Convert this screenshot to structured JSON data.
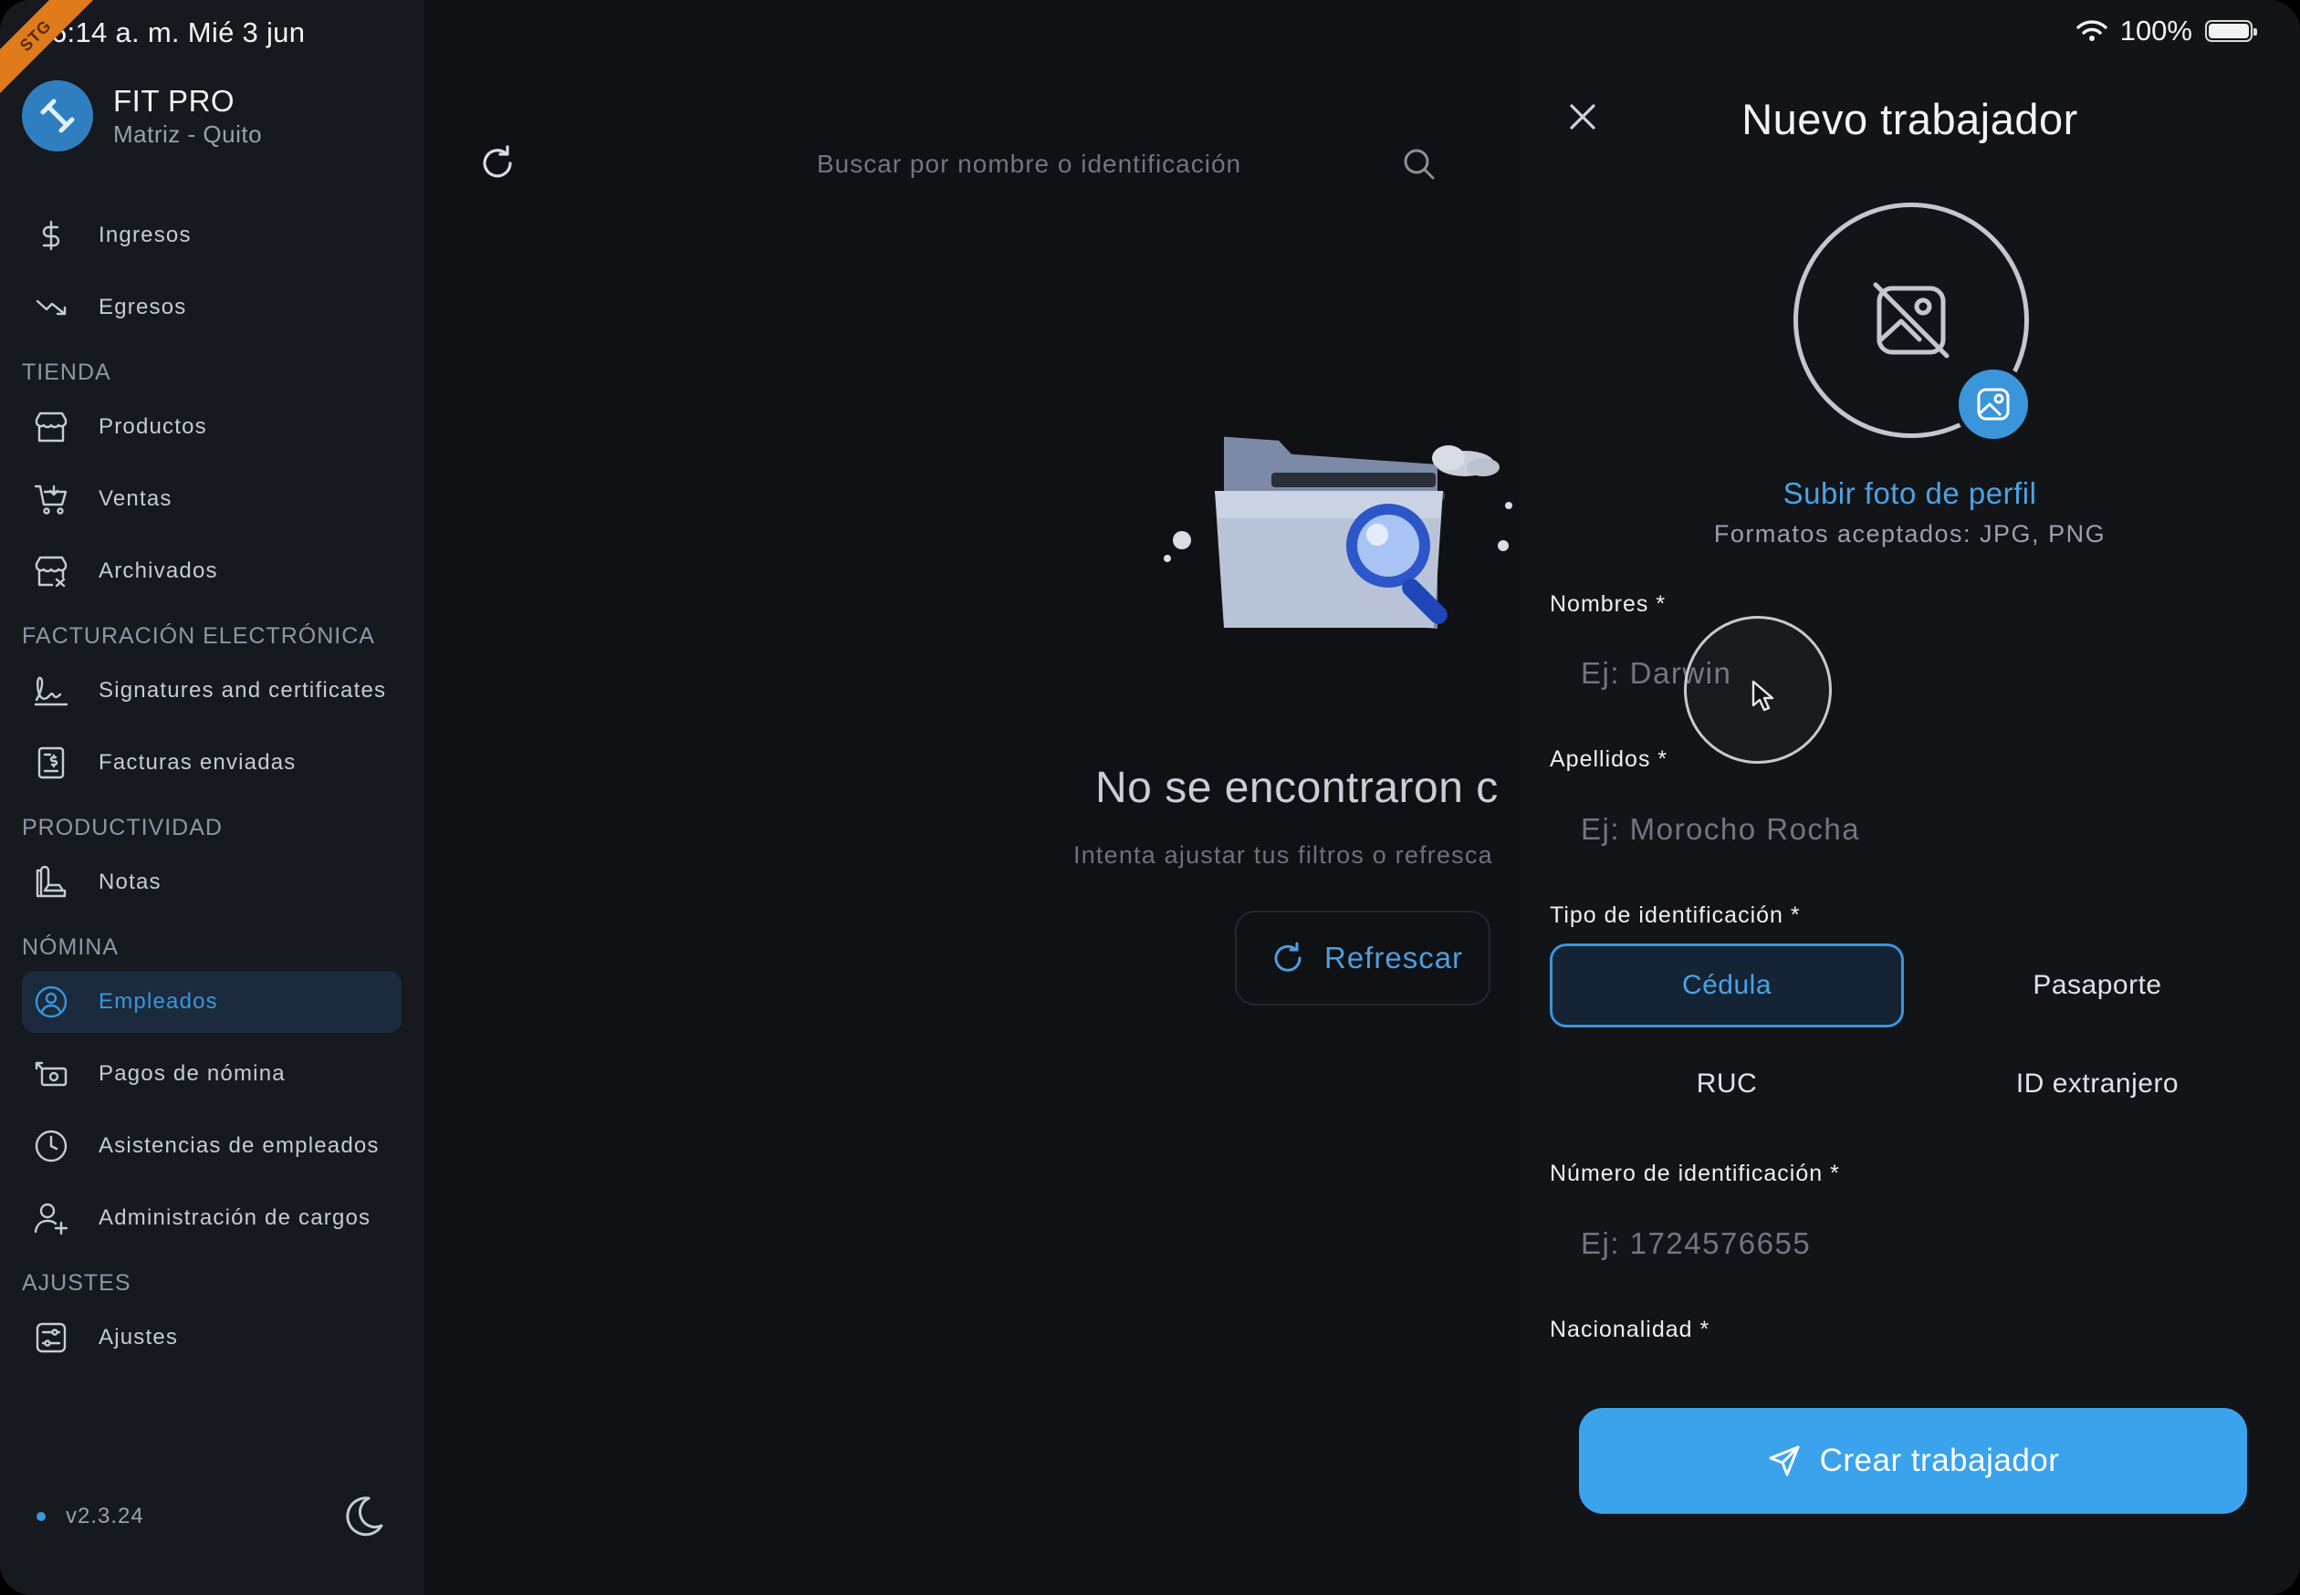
{
  "status_bar": {
    "time": "6:14 a. m.  Mié 3 jun",
    "battery": "100%",
    "ribbon": "STG"
  },
  "brand": {
    "name": "FIT PRO",
    "location": "Matriz - Quito"
  },
  "sidebar": {
    "top_items": [
      {
        "label": "Ingresos",
        "icon": "dollar-icon"
      },
      {
        "label": "Egresos",
        "icon": "trend-down-icon"
      }
    ],
    "sections": [
      {
        "title": "TIENDA",
        "items": [
          {
            "label": "Productos",
            "icon": "store-icon"
          },
          {
            "label": "Ventas",
            "icon": "cart-icon"
          },
          {
            "label": "Archivados",
            "icon": "archived-store-icon"
          }
        ]
      },
      {
        "title": "FACTURACIÓN ELECTRÓNICA",
        "items": [
          {
            "label": "Signatures and certificates",
            "icon": "signature-icon"
          },
          {
            "label": "Facturas enviadas",
            "icon": "receipt-icon"
          }
        ]
      },
      {
        "title": "PRODUCTIVIDAD",
        "items": [
          {
            "label": "Notas",
            "icon": "clipboard-icon"
          }
        ]
      },
      {
        "title": "NÓMINA",
        "items": [
          {
            "label": "Empleados",
            "icon": "user-circle-icon",
            "active": true
          },
          {
            "label": "Pagos de nómina",
            "icon": "money-icon"
          },
          {
            "label": "Asistencias de empleados",
            "icon": "clock-icon"
          },
          {
            "label": "Administración de cargos",
            "icon": "user-plus-icon"
          }
        ]
      },
      {
        "title": "AJUSTES",
        "items": [
          {
            "label": "Ajustes",
            "icon": "settings-icon"
          }
        ]
      }
    ],
    "version": "v2.3.24"
  },
  "main": {
    "search_placeholder": "Buscar por nombre o identificación",
    "empty_title": "No se encontraron c",
    "empty_subtitle": "Intenta ajustar tus filtros o refresca",
    "refresh_label": "Refrescar"
  },
  "panel": {
    "title": "Nuevo trabajador",
    "upload_label": "Subir foto de perfil",
    "upload_hint": "Formatos aceptados: JPG, PNG",
    "nombres_label": "Nombres *",
    "nombres_placeholder": "Ej: Darwin",
    "apellidos_label": "Apellidos *",
    "apellidos_placeholder": "Ej: Morocho Rocha",
    "tipo_label": "Tipo de identificación *",
    "tipo_options": [
      "Cédula",
      "Pasaporte",
      "RUC",
      "ID extranjero"
    ],
    "tipo_selected": "Cédula",
    "numero_label": "Número de identificación *",
    "numero_placeholder": "Ej: 1724576655",
    "nacionalidad_label": "Nacionalidad *",
    "create_label": "Crear trabajador"
  },
  "colors": {
    "accent": "#3b95db",
    "button": "#3ba3ec",
    "background": "#121418",
    "sidebar": "#16191e"
  }
}
